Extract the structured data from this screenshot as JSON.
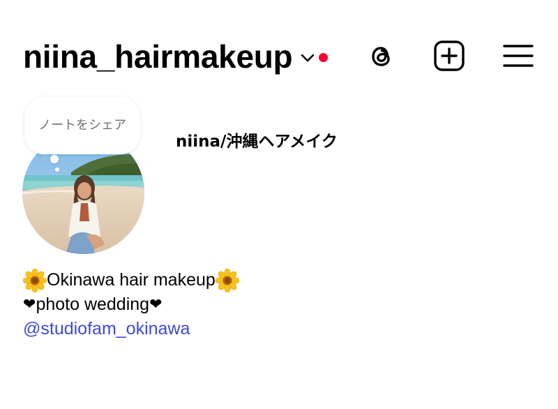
{
  "header": {
    "username": "niina_hairmakeup",
    "notification_color": "#ff0033",
    "icons": [
      "chevron-down-icon",
      "threads-icon",
      "create-post-icon",
      "hamburger-menu-icon"
    ]
  },
  "note": {
    "text": "ノートをシェア"
  },
  "profile": {
    "display_name": "niina/沖縄ヘアメイク",
    "avatar": "profile-photo-beach"
  },
  "bio": {
    "line1": "Okinawa hair makeup",
    "line1_emoji": "sunflower-icon",
    "line2_heart": "❤",
    "line2": "photo wedding",
    "link": "@studiofam_okinawa",
    "link_color": "#3b49df"
  }
}
